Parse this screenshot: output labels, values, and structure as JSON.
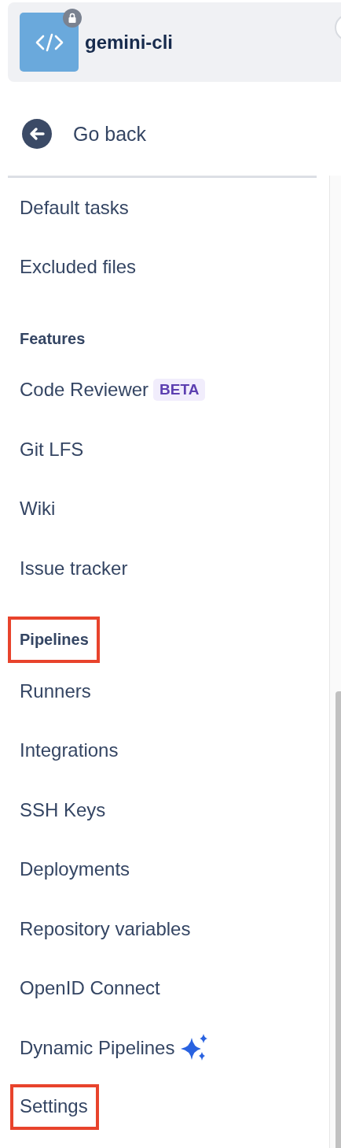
{
  "repository": {
    "name": "gemini-cli",
    "private": true
  },
  "back_link": {
    "label": "Go back"
  },
  "items": [
    {
      "kind": "link",
      "label": "Default tasks",
      "highlighted": false
    },
    {
      "kind": "link",
      "label": "Excluded files",
      "highlighted": false
    },
    {
      "kind": "heading",
      "label": "Features",
      "highlighted": false
    },
    {
      "kind": "link",
      "label": "Code Reviewer",
      "badge": "BETA",
      "highlighted": false
    },
    {
      "kind": "link",
      "label": "Git LFS",
      "highlighted": false
    },
    {
      "kind": "link",
      "label": "Wiki",
      "highlighted": false
    },
    {
      "kind": "link",
      "label": "Issue tracker",
      "highlighted": false
    },
    {
      "kind": "heading",
      "label": "Pipelines",
      "highlighted": true
    },
    {
      "kind": "link",
      "label": "Runners",
      "highlighted": false
    },
    {
      "kind": "link",
      "label": "Integrations",
      "highlighted": false
    },
    {
      "kind": "link",
      "label": "SSH Keys",
      "highlighted": false
    },
    {
      "kind": "link",
      "label": "Deployments",
      "highlighted": false
    },
    {
      "kind": "link",
      "label": "Repository variables",
      "highlighted": false
    },
    {
      "kind": "link",
      "label": "OpenID Connect",
      "highlighted": false
    },
    {
      "kind": "link",
      "label": "Dynamic Pipelines",
      "ai": true,
      "highlighted": false
    },
    {
      "kind": "link",
      "label": "Settings",
      "highlighted": true
    }
  ]
}
